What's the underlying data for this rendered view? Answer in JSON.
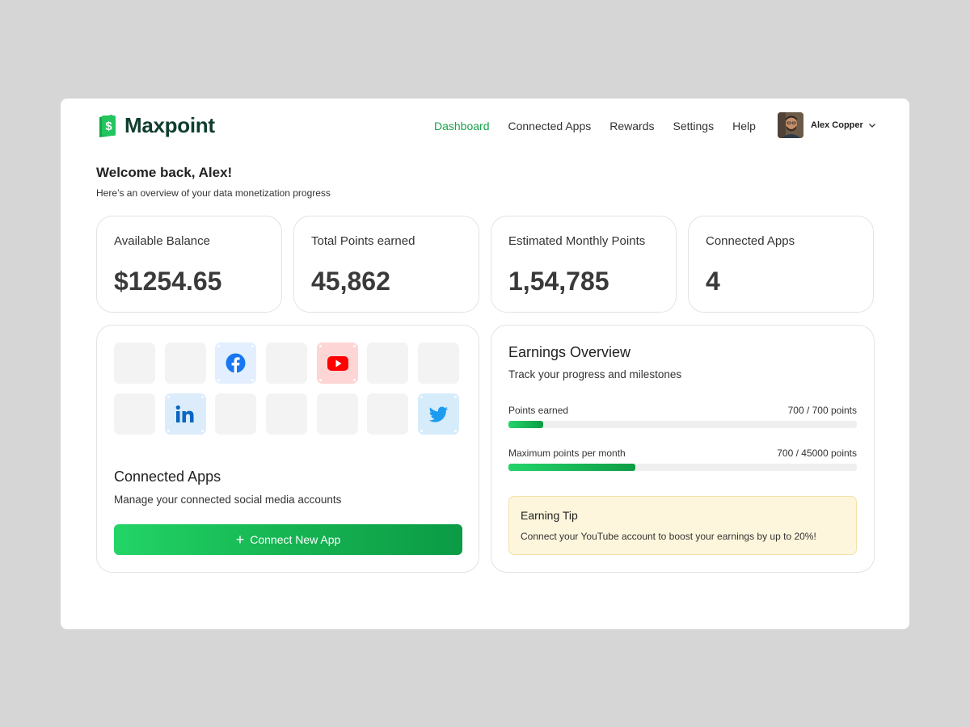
{
  "app": {
    "name": "Maxpoint",
    "brand_color": "#1aa34a"
  },
  "nav": {
    "items": [
      "Dashboard",
      "Connected Apps",
      "Rewards",
      "Settings",
      "Help"
    ],
    "active": "Dashboard"
  },
  "user": {
    "name": "Alex Copper",
    "avatar": "avatar-photo"
  },
  "welcome": {
    "title": "Welcome back, Alex!",
    "subtitle": "Here’s an overview of your data monetization progress"
  },
  "stats": [
    {
      "label": "Available Balance",
      "value": "$1254.65"
    },
    {
      "label": "Total Points earned",
      "value": "45,862"
    },
    {
      "label": "Estimated Monthly Points",
      "value": "1,54,785"
    },
    {
      "label": "Connected Apps",
      "value": "4"
    }
  ],
  "connected_apps": {
    "grid": [
      [
        "empty",
        "empty",
        "facebook-icon",
        "empty",
        "youtube-icon",
        "empty",
        "empty"
      ],
      [
        "empty",
        "linkedin-icon",
        "empty",
        "empty",
        "empty",
        "empty",
        "twitter-icon"
      ]
    ],
    "title": "Connected Apps",
    "subtitle": "Manage your connected social media accounts",
    "button_label": "Connect New App"
  },
  "earnings": {
    "title": "Earnings Overview",
    "subtitle": "Track your progress and milestones",
    "progress": [
      {
        "label": "Points earned",
        "value_text": "700 / 700 points",
        "fill_fraction": 0.1
      },
      {
        "label": "Maximum points per month",
        "value_text": "700 / 45000 points",
        "fill_fraction": 0.365
      }
    ],
    "tip": {
      "title": "Earning Tip",
      "body": "Connect your YouTube account to boost your earnings by up to 20%!"
    }
  }
}
